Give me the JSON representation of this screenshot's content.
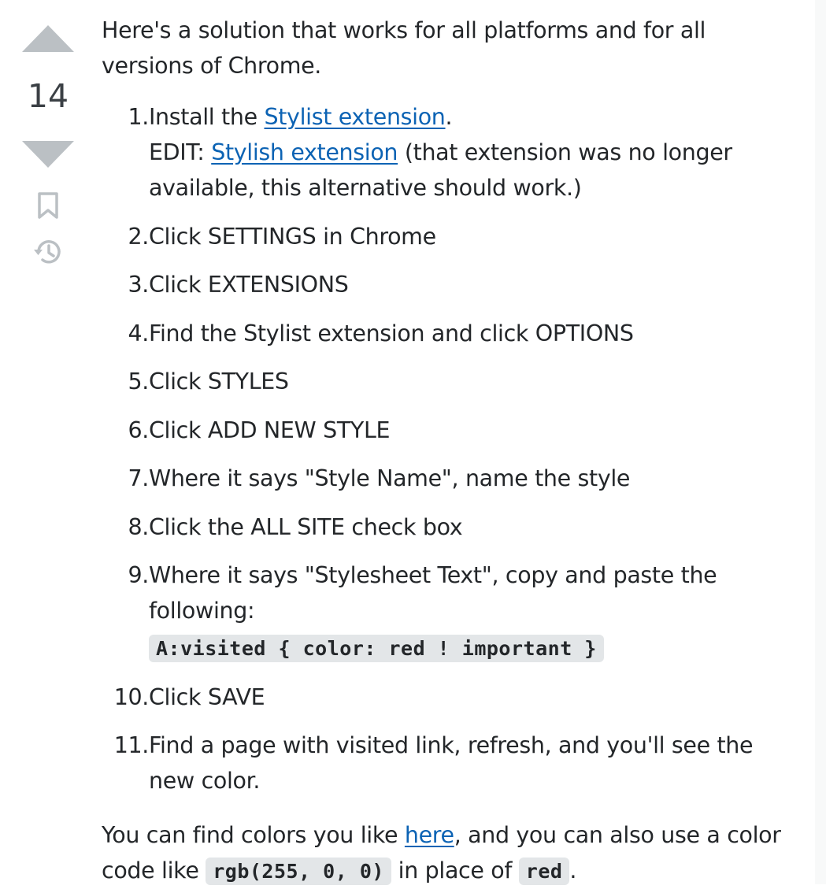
{
  "vote": {
    "score": "14"
  },
  "icons": {
    "upvote": "up-triangle",
    "downvote": "down-triangle",
    "bookmark": "bookmark-icon",
    "history": "history-icon"
  },
  "colors": {
    "link": "#0c63b4",
    "code_bg": "#e3e6e8",
    "vote_icon": "#bbc0c4"
  },
  "post": {
    "intro": "Here's a solution that works for all platforms and for all versions of Chrome.",
    "steps": [
      {
        "num": "1.",
        "prefix": "Install the ",
        "struck_link": "Stylist extension",
        "suffix": ".",
        "edit_prefix": "EDIT: ",
        "edit_link": "Stylish extension",
        "edit_suffix": " (that extension was no longer available, this alternative should work.)"
      },
      {
        "num": "2.",
        "text": "Click SETTINGS in Chrome"
      },
      {
        "num": "3.",
        "text": "Click EXTENSIONS"
      },
      {
        "num": "4.",
        "text": "Find the Stylist extension and click OPTIONS"
      },
      {
        "num": "5.",
        "text": "Click STYLES"
      },
      {
        "num": "6.",
        "text": "Click ADD NEW STYLE"
      },
      {
        "num": "7.",
        "text": "Where it says \"Style Name\", name the style"
      },
      {
        "num": "8.",
        "text": "Click the ALL SITE check box"
      },
      {
        "num": "9.",
        "text": "Where it says \"Stylesheet Text\", copy and paste the following:",
        "code": "A:visited { color: red ! important }"
      },
      {
        "num": "10.",
        "text": "Click SAVE"
      },
      {
        "num": "11.",
        "text": "Find a page with visited link, refresh, and you'll see the new color."
      }
    ],
    "outro": {
      "part1": "You can find colors you like ",
      "link": "here",
      "part2": ", and you can also use a color code like ",
      "code1": "rgb(255, 0, 0)",
      "part3": " in place of ",
      "code2": "red",
      "part4": "."
    }
  }
}
